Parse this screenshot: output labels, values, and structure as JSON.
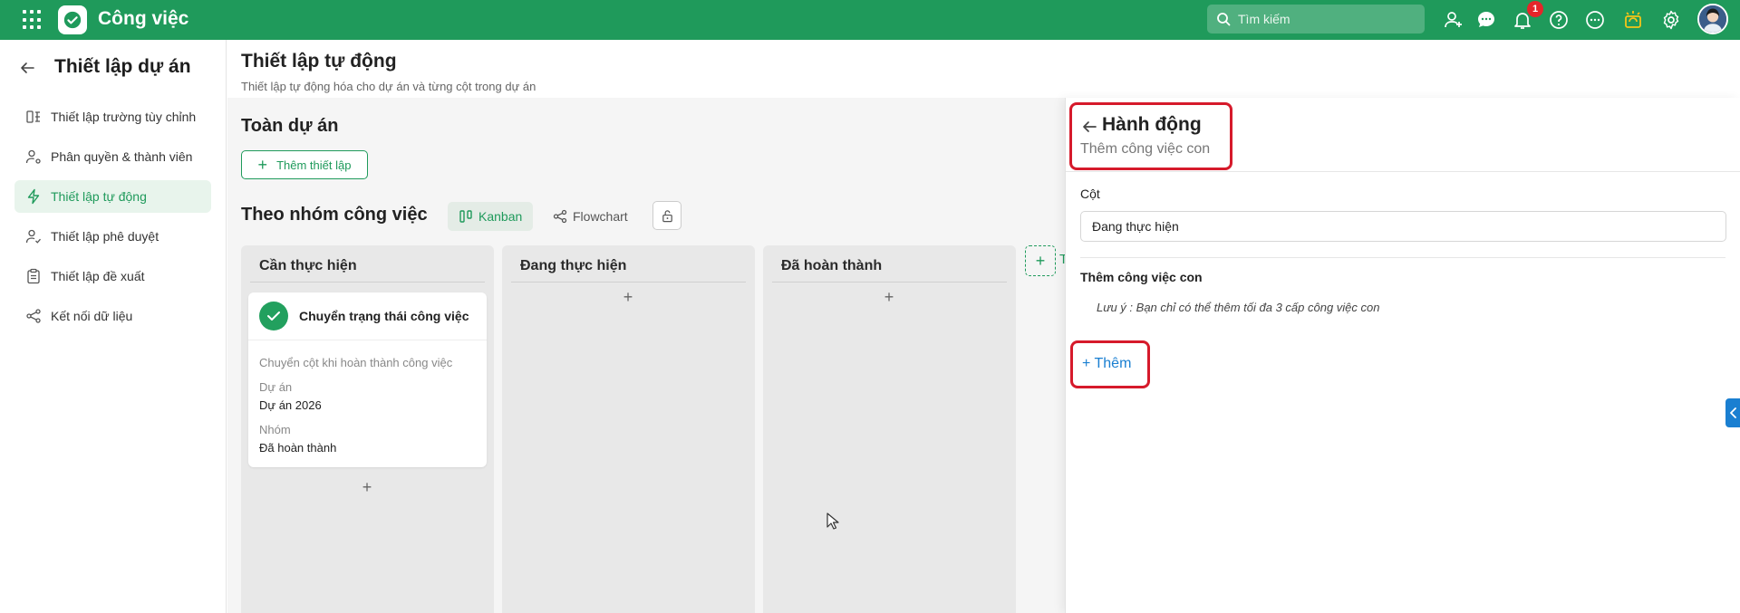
{
  "app": {
    "title": "Công việc",
    "search_placeholder": "Tìm kiếm",
    "notification_count": "1",
    "brand_color": "#1f9a5b"
  },
  "sidebar": {
    "title": "Thiết lập dự án",
    "items": [
      {
        "label": "Thiết lập trường tùy chỉnh",
        "icon": "custom-field-icon"
      },
      {
        "label": "Phân quyền & thành viên",
        "icon": "user-gear-icon"
      },
      {
        "label": "Thiết lập tự động",
        "icon": "lightning-icon",
        "active": true
      },
      {
        "label": "Thiết lập phê duyệt",
        "icon": "user-check-icon"
      },
      {
        "label": "Thiết lập đề xuất",
        "icon": "clipboard-icon"
      },
      {
        "label": "Kết nối dữ liệu",
        "icon": "share-nodes-icon"
      }
    ]
  },
  "main": {
    "title": "Thiết lập tự động",
    "subtitle": "Thiết lập tự động hóa cho dự án và từng cột trong dự án",
    "whole_project": {
      "title": "Toàn dự án",
      "add_label": "Thêm thiết lập"
    },
    "group": {
      "title": "Theo nhóm công việc",
      "tabs": [
        {
          "label": "Kanban",
          "active": true
        },
        {
          "label": "Flowchart",
          "active": false
        }
      ],
      "columns": [
        {
          "title": "Cần thực hiện",
          "card": {
            "title": "Chuyển trạng thái công việc",
            "description": "Chuyển cột khi hoàn thành công việc",
            "project_label": "Dự án",
            "project_value": "Dự án 2026",
            "group_label": "Nhóm",
            "group_value": "Đã hoàn thành"
          }
        },
        {
          "title": "Đang thực hiện"
        },
        {
          "title": "Đã hoàn thành"
        }
      ],
      "add_column_partial": "T"
    }
  },
  "panel": {
    "title": "Hành động",
    "subtitle": "Thêm công việc con",
    "column_label": "Cột",
    "column_value": "Đang thực hiện",
    "subtask_label": "Thêm công việc con",
    "note": "Lưu ý : Bạn chỉ có thể thêm tối đa 3 cấp công việc con",
    "add_label": "+ Thêm",
    "highlight_color": "#d61a2b",
    "link_color": "#1a7fd1"
  }
}
